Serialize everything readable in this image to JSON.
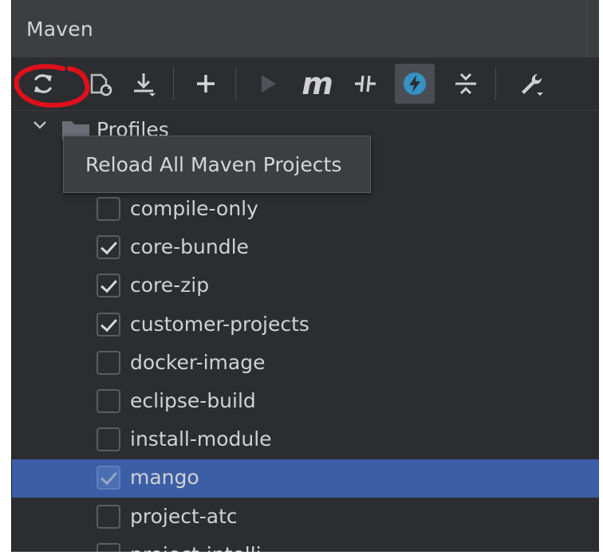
{
  "window": {
    "title": "Maven"
  },
  "toolbar": {
    "buttons": [
      {
        "id": "reload",
        "icon": "reload-icon",
        "tooltip": "Reload All Maven Projects"
      },
      {
        "id": "generate",
        "icon": "generate-sources-icon"
      },
      {
        "id": "download",
        "icon": "download-icon"
      },
      {
        "id": "add",
        "icon": "plus-icon"
      },
      {
        "id": "run",
        "icon": "run-icon"
      },
      {
        "id": "execute-goal",
        "icon": "maven-m-icon",
        "text": "m"
      },
      {
        "id": "toggle-offline",
        "icon": "toggle-offline-icon"
      },
      {
        "id": "skip-tests",
        "icon": "lightning-icon",
        "active": true
      },
      {
        "id": "collapse",
        "icon": "collapse-all-icon"
      },
      {
        "id": "settings",
        "icon": "wrench-icon"
      }
    ]
  },
  "tooltip": {
    "text": "Reload All Maven Projects"
  },
  "tree": {
    "profiles_label": "Profiles",
    "profiles": [
      {
        "name": "compile-only",
        "checked": false
      },
      {
        "name": "core-bundle",
        "checked": true
      },
      {
        "name": "core-zip",
        "checked": true
      },
      {
        "name": "customer-projects",
        "checked": true
      },
      {
        "name": "docker-image",
        "checked": false
      },
      {
        "name": "eclipse-build",
        "checked": false
      },
      {
        "name": "install-module",
        "checked": false
      },
      {
        "name": "mango",
        "checked": true,
        "selected": true
      },
      {
        "name": "project-atc",
        "checked": false
      },
      {
        "name": "project-intelli",
        "checked": false
      }
    ]
  },
  "colors": {
    "panel_bg": "#2b2d30",
    "header_bg": "#3c3f41",
    "selection": "#3b5ea6",
    "annotation": "#e0101a",
    "accent_blue": "#3592c4"
  }
}
